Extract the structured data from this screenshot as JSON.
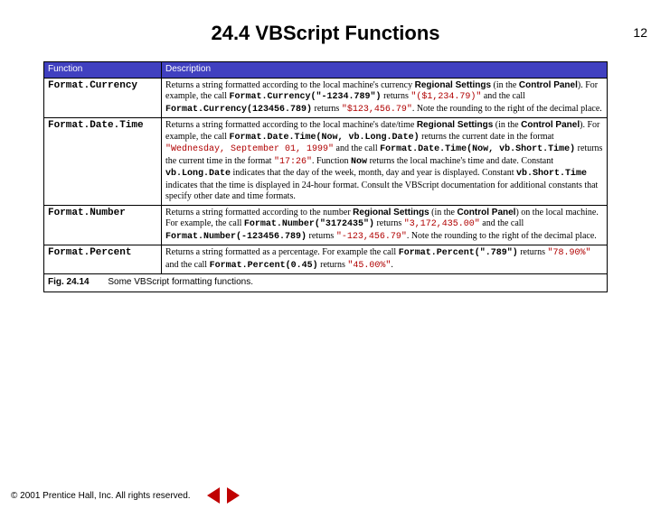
{
  "page_number": "12",
  "title": "24.4 VBScript Functions",
  "table": {
    "headers": [
      "Function",
      "Description"
    ],
    "rows": [
      {
        "fn": "Format.Currency",
        "desc_html": "Returns a string formatted according to the local machine's currency <b>Regional Settings</b> (in the <b>Control Panel</b>). For example, the call <code>Format.Currency(\"-1234.789\")</code> returns <span class='lit'>\"($1,234.79)\"</span> and the call <code>Format.Currency(123456.789)</code> returns <span class='lit'>\"$123,456.79\"</span>. Note the rounding to the right of the decimal place."
      },
      {
        "fn": "Format.Date.Time",
        "desc_html": "Returns a string formatted according to the local machine's date/time <b>Regional Settings</b> (in the <b>Control Panel</b>). For example, the call <code>Format.Date.Time(Now, vb.Long.Date)</code> returns the current date in the format <span class='lit'>\"Wednesday, September 01, 1999\"</span> and the call <code>Format.Date.Time(Now, vb.Short.Time)</code> returns the current time in the format <span class='lit'>\"17:26\"</span>. Function <code>Now</code> returns the local machine's time and date. Constant <code>vb.Long.Date</code> indicates that the day of the week, month, day and year is displayed. Constant <code>vb.Short.Time</code> indicates that the time is displayed in 24-hour format. Consult the VBScript documentation for additional constants that specify other date and time formats."
      },
      {
        "fn": "Format.Number",
        "desc_html": "Returns a string formatted according to the number <b>Regional Settings</b> (in the <b>Control Panel</b>) on the local machine. For example, the call <code>Format.Number(\"3172435\")</code> returns <span class='lit'>\"3,172,435.00\"</span> and the call <code>Format.Number(-123456.789)</code> returns <span class='lit'>\"-123,456.79\"</span>. Note the rounding to the right of the decimal place."
      },
      {
        "fn": "Format.Percent",
        "desc_html": "Returns a string formatted as a percentage. For example the call <code>Format.Percent(\".789\")</code> returns <span class='lit'>\"78.90%\"</span> and the call <code>Format.Percent(0.45)</code> returns <span class='lit'>\"45.00%\"</span>."
      }
    ],
    "caption_num": "Fig. 24.14",
    "caption_text": "Some VBScript formatting functions."
  },
  "footer": {
    "copyright": "© 2001 Prentice Hall, Inc. All rights reserved."
  }
}
